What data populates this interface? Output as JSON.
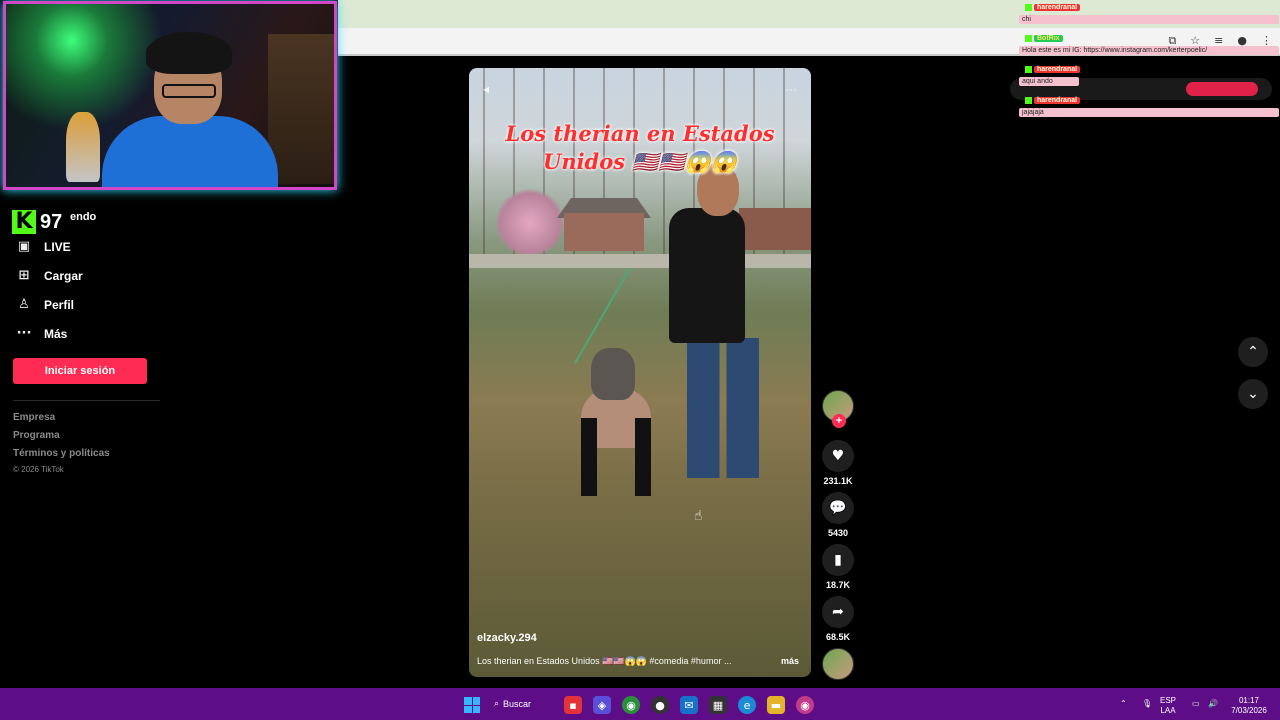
{
  "sidebar": {
    "kick_count": "97",
    "partial_item": "endo",
    "items": [
      {
        "label": "LIVE",
        "icon": "live-icon"
      },
      {
        "label": "Cargar",
        "icon": "upload-icon"
      },
      {
        "label": "Perfil",
        "icon": "profile-icon"
      },
      {
        "label": "Más",
        "icon": "more-icon"
      }
    ],
    "login_label": "Iniciar sesión",
    "footer_links": [
      "Empresa",
      "Programa",
      "Términos y políticas"
    ],
    "copyright": "© 2026 TikTok"
  },
  "video": {
    "title_line1": "Los therian en Estados",
    "title_line2": "Unidos 🇺🇸🇺🇸😱😱",
    "username": "elzacky.294",
    "caption": "Los therian en Estados Unidos 🇺🇸🇺🇸😱😱 #comedia #humor ...",
    "more_label": "más"
  },
  "actions": {
    "likes": "231.1K",
    "comments": "5430",
    "saves": "18.7K",
    "shares": "68.5K"
  },
  "chat": [
    {
      "user": "harendranal",
      "text": "chi"
    },
    {
      "user": "BotRix",
      "text": "Hola este es mi IG: https://www.instagram.com/kerterpoelic/"
    },
    {
      "user": "harendranal",
      "text": "aqui ando"
    },
    {
      "user": "harendranal",
      "text": "jajajaja"
    }
  ],
  "taskbar": {
    "search_label": "Buscar",
    "lang": "ESP",
    "lang_region": "LAA",
    "time": "01:17",
    "date": "7/03/2026"
  },
  "colors": {
    "accent": "#fe2c55",
    "kick_green": "#53fc18",
    "taskbar": "#5d0e86"
  }
}
